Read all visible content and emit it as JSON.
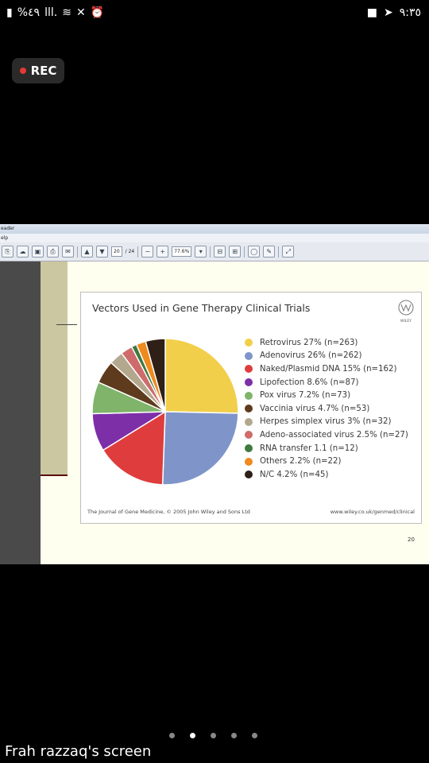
{
  "status_bar": {
    "battery": "%٤٩",
    "signal": "lll.",
    "time": "٩:٣٥",
    "icons": [
      "battery-icon",
      "signal-icon",
      "wifi-icon",
      "mute-icon",
      "alarm-icon",
      "video-icon",
      "telegram-icon"
    ]
  },
  "recording": {
    "label": "REC",
    "color": "#e53935"
  },
  "viewer": {
    "title_text": "eader",
    "menu_text": "elp",
    "page_current": "20",
    "page_total": "/ 24",
    "zoom": "77.6%"
  },
  "slide": {
    "title": "Vectors Used in Gene Therapy Clinical Trials",
    "publisher_logo_text": "WILEY",
    "footer_left": "The Journal of Gene Medicine, © 2005 John Wiley and Sons Ltd",
    "footer_right": "www.wiley.co.uk/genmed/clinical",
    "page_number": "20"
  },
  "chart_data": {
    "type": "pie",
    "title": "Vectors Used in Gene Therapy Clinical Trials",
    "slices": [
      {
        "label": "Retrovirus 27% (n=263)",
        "value": 263,
        "color": "#f2cf4a"
      },
      {
        "label": "Adenovirus 26% (n=262)",
        "value": 262,
        "color": "#7f95c9"
      },
      {
        "label": "Naked/Plasmid DNA 15% (n=162)",
        "value": 162,
        "color": "#df3d3d"
      },
      {
        "label": "Lipofection 8.6% (n=87)",
        "value": 87,
        "color": "#7d2fa8"
      },
      {
        "label": "Pox virus 7.2% (n=73)",
        "value": 73,
        "color": "#7fb46a"
      },
      {
        "label": "Vaccinia virus 4.7% (n=53)",
        "value": 53,
        "color": "#5e3b1d"
      },
      {
        "label": "Herpes simplex virus 3% (n=32)",
        "value": 32,
        "color": "#b3a88e"
      },
      {
        "label": "Adeno-associated virus 2.5% (n=27)",
        "value": 27,
        "color": "#cf6b6b"
      },
      {
        "label": "RNA transfer 1.1 (n=12)",
        "value": 12,
        "color": "#3f7a3f"
      },
      {
        "label": "Others 2.2% (n=22)",
        "value": 22,
        "color": "#ef8a1f"
      },
      {
        "label": "N/C 4.2% (n=45)",
        "value": 45,
        "color": "#2e1f17"
      }
    ],
    "legend_position": "right"
  },
  "pager": {
    "count": 5,
    "active": 1
  },
  "caption": "Frah razzaq's screen"
}
